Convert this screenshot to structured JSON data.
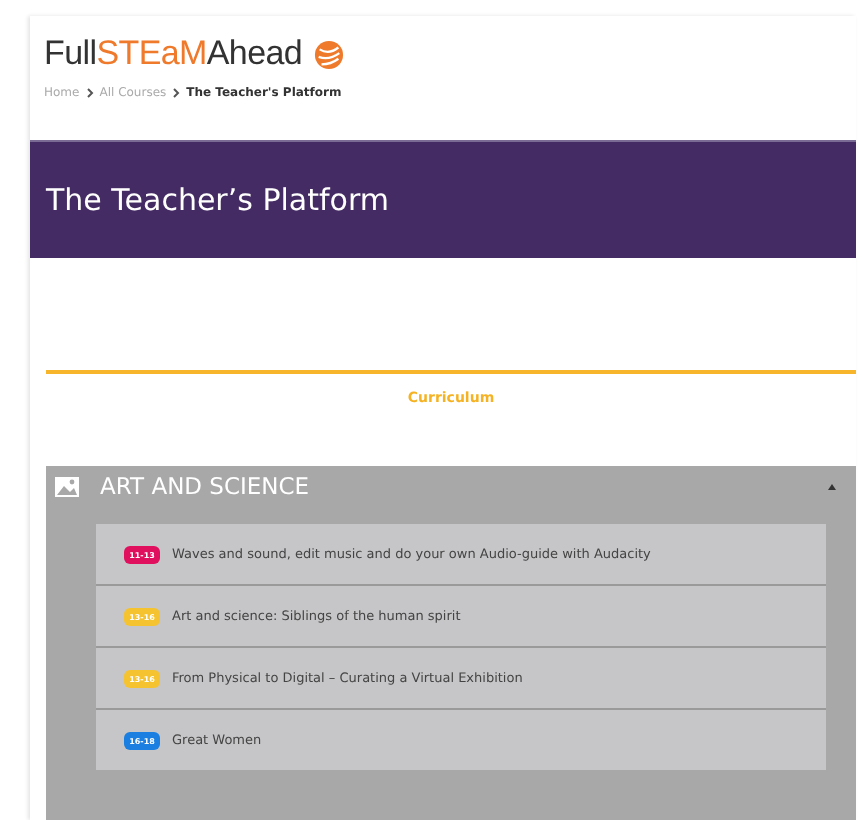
{
  "logo": {
    "parts": [
      "Full",
      "STEaM",
      "Ahead"
    ]
  },
  "breadcrumb": [
    {
      "label": "Home",
      "current": false
    },
    {
      "label": "All Courses",
      "current": false
    },
    {
      "label": "The Teacher's Platform",
      "current": true
    }
  ],
  "banner": {
    "title": "The Teacher’s Platform"
  },
  "tabs": [
    {
      "label": "Curriculum",
      "selected": true
    }
  ],
  "section": {
    "title": "ART AND SCIENCE",
    "expanded": true,
    "courses": [
      {
        "age": "11-13",
        "color": "#e0105e",
        "title": "Waves and sound, edit music and do your own Audio-guide with Audacity"
      },
      {
        "age": "13-16",
        "color": "#f5c330",
        "title": "Art and science: Siblings of the human spirit"
      },
      {
        "age": "13-16",
        "color": "#f5c330",
        "title": "From Physical to Digital – Curating a Virtual Exhibition"
      },
      {
        "age": "16-18",
        "color": "#1a7fe0",
        "title": "Great Women"
      }
    ]
  }
}
